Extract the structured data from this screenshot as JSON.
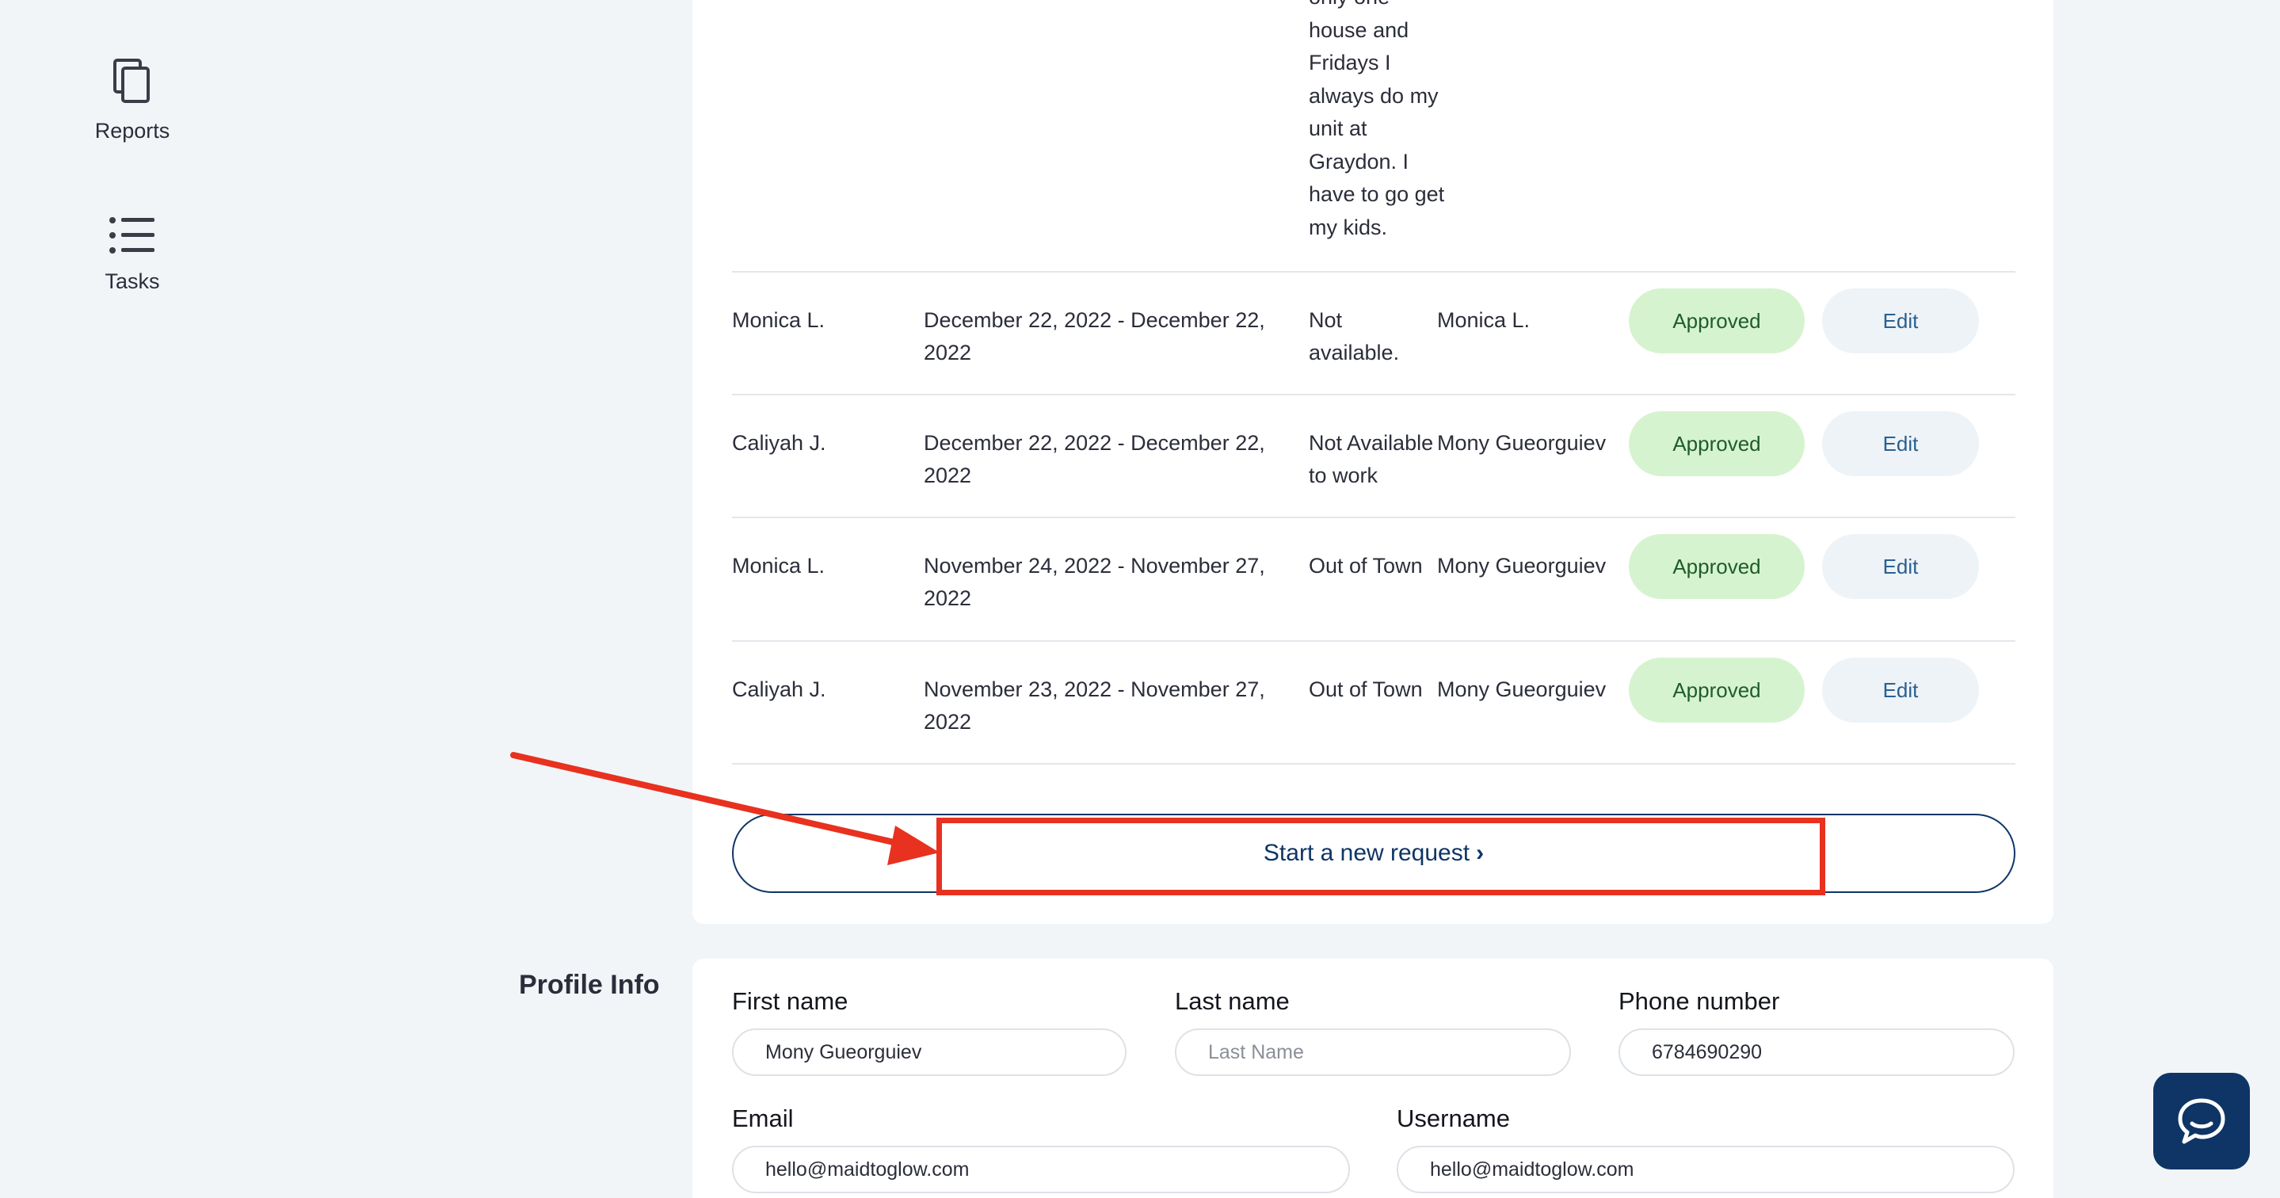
{
  "sidebar": {
    "items": [
      {
        "label": "Reports",
        "icon": "copy-icon"
      },
      {
        "label": "Tasks",
        "icon": "list-icon"
      }
    ]
  },
  "requests": {
    "note_overflow_lines": [
      "only one",
      "house and",
      "Fridays I",
      "always do my",
      "unit at",
      "Graydon. I",
      "have to go get",
      "my kids."
    ],
    "rows": [
      {
        "name": "Monica L.",
        "dates": "December 22, 2022 - December 22, 2022",
        "reason": "Not available.",
        "approver": "Monica L.",
        "status": "Approved",
        "action": "Edit"
      },
      {
        "name": "Caliyah J.",
        "dates": "December 22, 2022 - December 22, 2022",
        "reason": "Not Available to work",
        "approver": "Mony Gueorguiev",
        "status": "Approved",
        "action": "Edit"
      },
      {
        "name": "Monica L.",
        "dates": "November 24, 2022 - November 27, 2022",
        "reason": "Out of Town",
        "approver": "Mony Gueorguiev",
        "status": "Approved",
        "action": "Edit"
      },
      {
        "name": "Caliyah J.",
        "dates": "November 23, 2022 - November 27, 2022",
        "reason": "Out of Town",
        "approver": "Mony Gueorguiev",
        "status": "Approved",
        "action": "Edit"
      }
    ],
    "new_request_label": "Start a new request",
    "new_request_chevron": "›"
  },
  "profile": {
    "title": "Profile Info",
    "first_name": {
      "label": "First name",
      "value": "Mony Gueorguiev",
      "placeholder": ""
    },
    "last_name": {
      "label": "Last name",
      "value": "",
      "placeholder": "Last Name"
    },
    "phone": {
      "label": "Phone number",
      "value": "6784690290",
      "placeholder": ""
    },
    "email": {
      "label": "Email",
      "value": "hello@maidtoglow.com",
      "placeholder": ""
    },
    "username": {
      "label": "Username",
      "value": "hello@maidtoglow.com",
      "placeholder": ""
    }
  },
  "colors": {
    "accent": "#0e3566",
    "approved_bg": "#d6f3cf",
    "annotation": "#e8311f",
    "background": "#f1f5f8"
  },
  "chat": {
    "icon": "chat-bubble-icon"
  }
}
